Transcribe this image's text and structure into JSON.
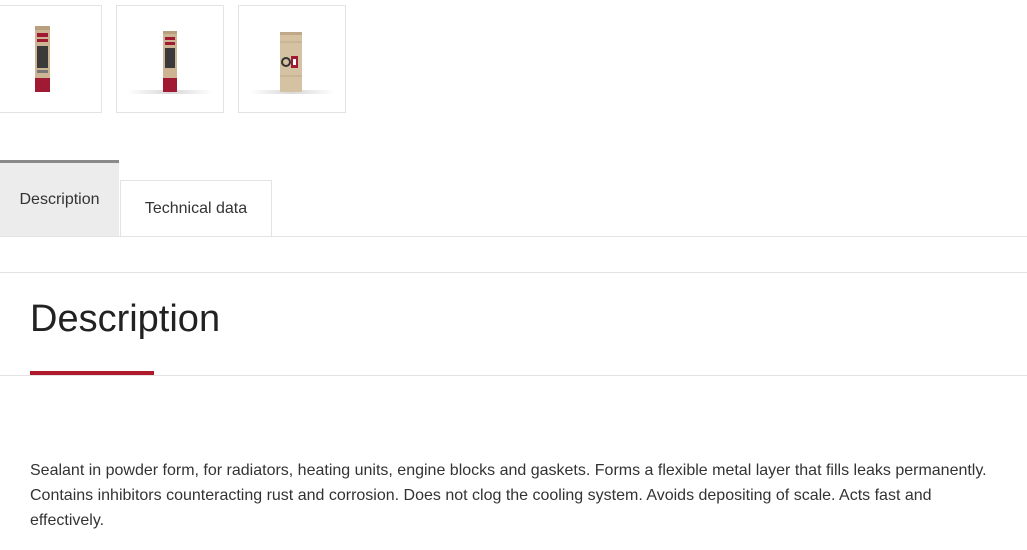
{
  "gallery": {
    "thumbnails": [
      {
        "label": "product-front-view"
      },
      {
        "label": "product-angle-view"
      },
      {
        "label": "product-back-view"
      }
    ],
    "colors": {
      "box": "#cdb593",
      "band": "#a11a33",
      "accent": "#333333"
    }
  },
  "tabs": {
    "description_label": "Description",
    "technical_label": "Technical data"
  },
  "section": {
    "title": "Description",
    "accent_color": "#b0182b",
    "text": "Sealant in powder form, for radiators, heating units, engine blocks and gaskets. Forms a flexible metal layer that fills leaks permanently. Contains inhibitors counteracting rust and corrosion. Does not clog the cooling system. Avoids depositing of scale. Acts fast and effectively."
  }
}
